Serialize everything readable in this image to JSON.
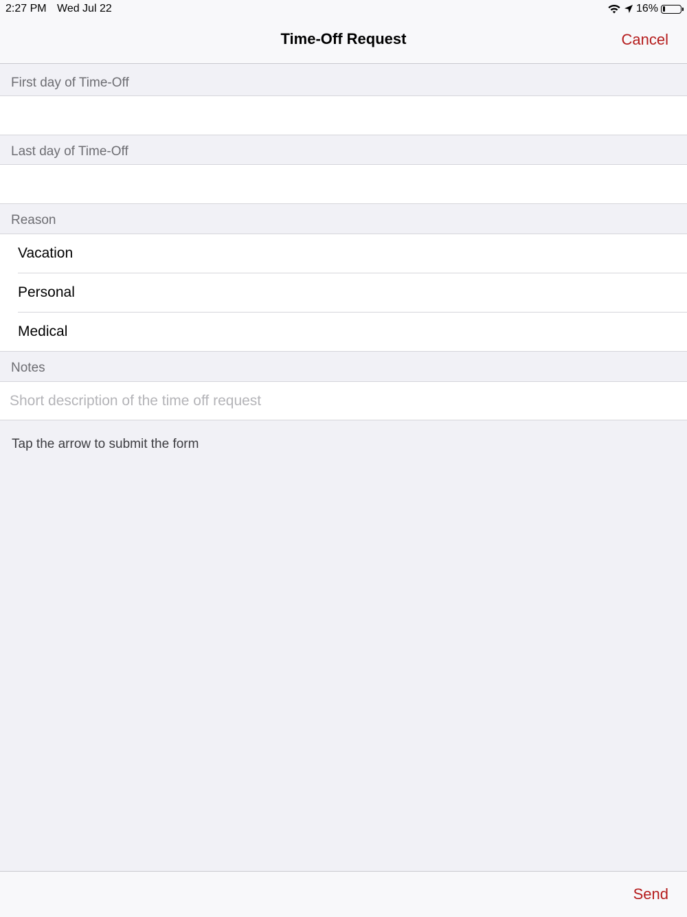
{
  "status_bar": {
    "time": "2:27 PM",
    "date": "Wed Jul 22",
    "battery_percent": "16%",
    "battery_level": 0.16
  },
  "nav": {
    "title": "Time-Off Request",
    "cancel_label": "Cancel"
  },
  "form": {
    "first_day": {
      "label": "First day of Time-Off",
      "value": ""
    },
    "last_day": {
      "label": "Last day of Time-Off",
      "value": ""
    },
    "reason": {
      "label": "Reason",
      "options": [
        "Vacation",
        "Personal",
        "Medical"
      ]
    },
    "notes": {
      "label": "Notes",
      "value": "",
      "placeholder": "Short description of the time off request"
    },
    "hint": "Tap the arrow to submit the form"
  },
  "toolbar": {
    "send_label": "Send"
  },
  "colors": {
    "accent": "#b51c1c",
    "background": "#f1f1f6",
    "section_label": "#6d6d72"
  }
}
